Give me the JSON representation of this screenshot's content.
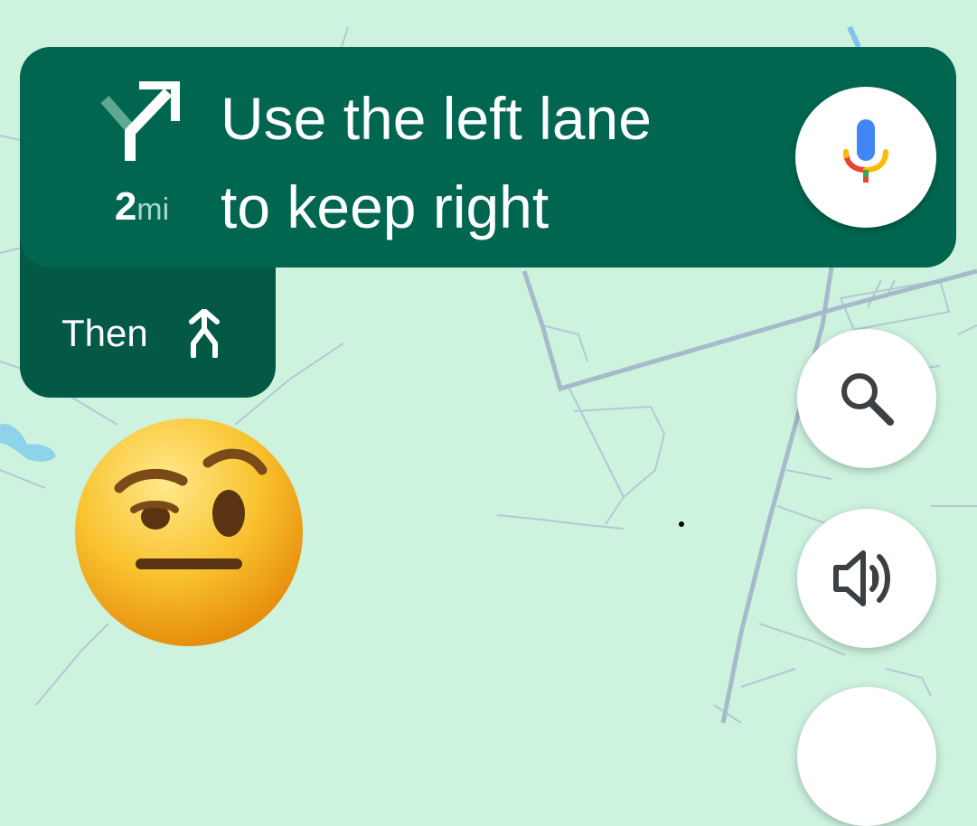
{
  "navigation": {
    "maneuver_icon": "fork-right-arrow-icon",
    "distance_value": "2",
    "distance_unit": "mi",
    "instruction_line1": "Use the left lane",
    "instruction_line2": "to keep right",
    "then_label": "Then",
    "then_icon": "merge-arrow-icon"
  },
  "controls": {
    "voice_search_icon": "microphone-icon",
    "search_icon": "search-icon",
    "sound_icon": "volume-icon"
  },
  "overlay": {
    "emoji": "face-with-raised-eyebrow"
  },
  "colors": {
    "banner": "#00664f",
    "then_panel": "#035946",
    "map_background": "#cdf3df",
    "roads": "#a8bfcf",
    "water": "#8fd3ea"
  }
}
